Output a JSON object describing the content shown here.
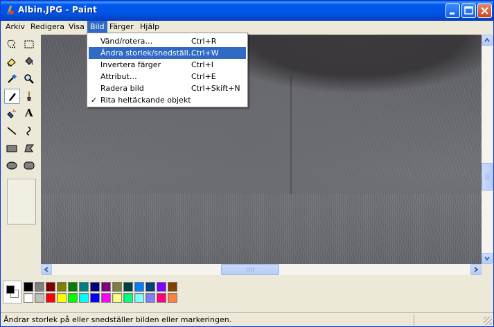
{
  "window": {
    "title": "Albin.JPG - Paint"
  },
  "menubar": {
    "items": [
      {
        "label": "Arkiv"
      },
      {
        "label": "Redigera"
      },
      {
        "label": "Visa"
      },
      {
        "label": "Bild"
      },
      {
        "label": "Färger"
      },
      {
        "label": "Hjälp"
      }
    ],
    "active": "Bild"
  },
  "dropdown": {
    "items": [
      {
        "label": "Vänd/rotera…",
        "shortcut": "Ctrl+R"
      },
      {
        "label": "Ändra storlek/snedställ…",
        "shortcut": "Ctrl+W"
      },
      {
        "label": "Invertera färger",
        "shortcut": "Ctrl+I"
      },
      {
        "label": "Attribut…",
        "shortcut": "Ctrl+E"
      },
      {
        "label": "Radera bild",
        "shortcut": "Ctrl+Skift+N"
      },
      {
        "label": "Rita heltäckande objekt",
        "shortcut": "",
        "check_mark": "✓"
      }
    ],
    "highlighted": "Ändra storlek/snedställ…"
  },
  "toolbox": {
    "tools": [
      "free-form-select-icon",
      "rectangle-select-icon",
      "eraser-icon",
      "fill-bucket-icon",
      "color-picker-icon",
      "magnifier-icon",
      "pencil-icon",
      "brush-icon",
      "airbrush-icon",
      "text-tool-icon",
      "line-tool-icon",
      "curve-tool-icon",
      "rectangle-tool-icon",
      "polygon-tool-icon",
      "ellipse-tool-icon",
      "rounded-rectangle-tool-icon"
    ],
    "selected": "pencil-icon",
    "text_tool_glyph": "A"
  },
  "palette": {
    "foreground": "#000000",
    "background": "#ffffff",
    "top_row": [
      "#000000",
      "#808080",
      "#800000",
      "#808000",
      "#008000",
      "#008080",
      "#000080",
      "#800080",
      "#808040",
      "#004040",
      "#0080ff",
      "#004080",
      "#8000ff",
      "#804000"
    ],
    "bottom_row": [
      "#ffffff",
      "#c0c0c0",
      "#ff0000",
      "#ffff00",
      "#00ff00",
      "#00ffff",
      "#0000ff",
      "#ff00ff",
      "#ffff80",
      "#00ff80",
      "#80ffff",
      "#8080ff",
      "#ff0080",
      "#ff8040"
    ]
  },
  "statusbar": {
    "text": "Ändrar storlek på eller snedställer bilden eller markeringen."
  },
  "colors": {
    "titlebar": "#0058ee",
    "menu_highlight": "#316ac5",
    "chrome": "#ece9d8"
  }
}
